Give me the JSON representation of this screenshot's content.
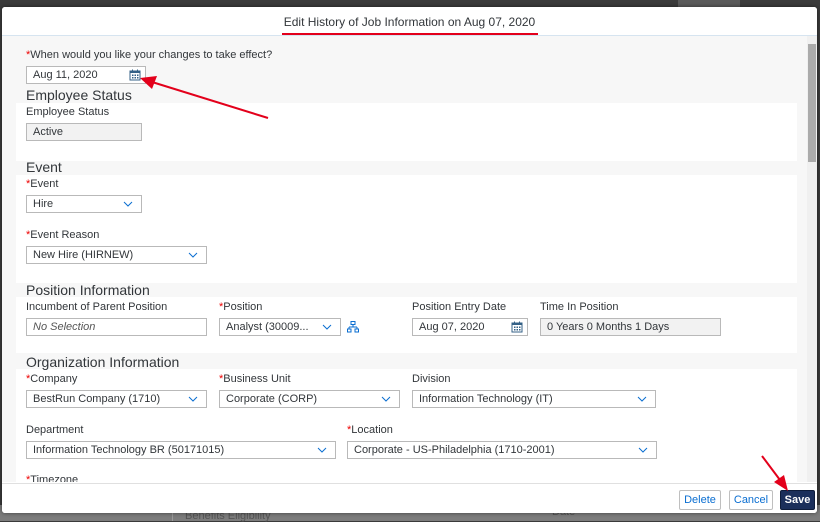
{
  "background": {
    "text_left": "Benefits Eligibility",
    "text_right": "Date"
  },
  "dialog": {
    "title": "Edit History of Job Information on Aug 07, 2020",
    "effective_date": {
      "label": "When would you like your changes to take effect?",
      "required": "*",
      "value": "Aug 11, 2020",
      "icon": "calendar-icon"
    },
    "sections": {
      "employee_status": {
        "title": "Employee Status",
        "fields": {
          "employee_status": {
            "label": "Employee Status",
            "value": "Active"
          }
        }
      },
      "event": {
        "title": "Event",
        "fields": {
          "event": {
            "label": "Event",
            "required": "*",
            "value": "Hire"
          },
          "event_reason": {
            "label": "Event Reason",
            "required": "*",
            "value": "New Hire (HIRNEW)"
          }
        }
      },
      "position_information": {
        "title": "Position Information",
        "fields": {
          "incumbent": {
            "label": "Incumbent of Parent Position",
            "value": "No Selection"
          },
          "position": {
            "label": "Position",
            "required": "*",
            "value": "Analyst (30009...",
            "icon": "org-chart-icon"
          },
          "position_entry_date": {
            "label": "Position Entry Date",
            "value": "Aug 07, 2020",
            "icon": "calendar-icon"
          },
          "time_in_position": {
            "label": "Time In Position",
            "value": "0 Years 0 Months 1 Days"
          }
        }
      },
      "organization_information": {
        "title": "Organization Information",
        "fields": {
          "company": {
            "label": "Company",
            "required": "*",
            "value": "BestRun Company (1710)"
          },
          "business_unit": {
            "label": "Business Unit",
            "required": "*",
            "value": "Corporate (CORP)"
          },
          "division": {
            "label": "Division",
            "value": "Information Technology (IT)"
          },
          "department": {
            "label": "Department",
            "value": "Information Technology BR (50171015)"
          },
          "location": {
            "label": "Location",
            "required": "*",
            "value": "Corporate - US-Philadelphia (1710-2001)"
          },
          "timezone": {
            "label": "Timezone",
            "required": "*"
          }
        }
      }
    },
    "footer": {
      "delete_label": "Delete",
      "cancel_label": "Cancel",
      "save_label": "Save"
    }
  },
  "colors": {
    "required": "#ee0000",
    "primary_button": "#1b2f5b",
    "link_blue": "#0a6ed1",
    "annotation_red": "#e3001b"
  }
}
